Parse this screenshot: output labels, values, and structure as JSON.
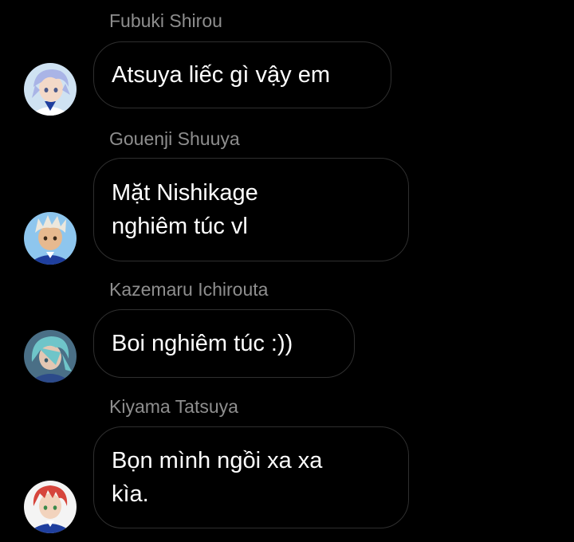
{
  "messages": [
    {
      "sender": "Fubuki Shirou",
      "lines": [
        "Atsuya liếc gì vậy em"
      ],
      "avatar": {
        "icon": "fubuki-avatar",
        "hair": "#a9b4e6",
        "skin": "#f3d9c8",
        "bg": "#cfe2f2",
        "shirt": "#ffffff"
      }
    },
    {
      "sender": "Gouenji Shuuya",
      "lines": [
        "Mặt Nishikage",
        "nghiêm túc vl"
      ],
      "avatar": {
        "icon": "gouenji-avatar",
        "hair": "#ece7dc",
        "skin": "#e6b98f",
        "bg": "#8ec6ee",
        "shirt": "#1f3f9e"
      }
    },
    {
      "sender": "Kazemaru Ichirouta",
      "lines": [
        "Boi nghiêm túc :))"
      ],
      "avatar": {
        "icon": "kazemaru-avatar",
        "hair": "#6fc5c9",
        "skin": "#e3c7b3",
        "bg": "#4a6f86",
        "shirt": "#2c4a8a"
      }
    },
    {
      "sender": "Kiyama Tatsuya",
      "lines": [
        "Bọn mình ngồi xa xa",
        "kìa."
      ],
      "avatar": {
        "icon": "kiyama-avatar",
        "hair": "#d6453c",
        "skin": "#f2d3bd",
        "bg": "#f4f4f4",
        "shirt": "#1f3f9e"
      }
    }
  ]
}
